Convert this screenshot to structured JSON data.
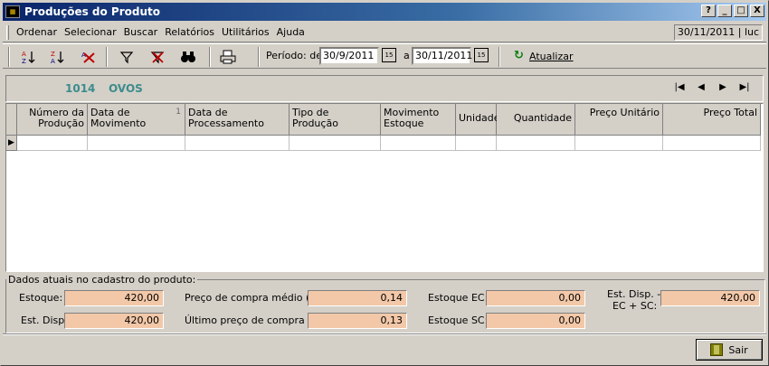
{
  "window": {
    "title": "Produções do Produto",
    "app_icon": "app-icon",
    "controls": [
      "?",
      "_",
      "□",
      "X"
    ]
  },
  "menu": {
    "items": [
      "Ordenar",
      "Selecionar",
      "Buscar",
      "Relatórios",
      "Utilitários",
      "Ajuda"
    ],
    "status": "30/11/2011 | luc"
  },
  "toolbar": {
    "buttons": [
      "sort-asc-icon",
      "sort-desc-icon",
      "clear-sort-icon",
      "filter-icon",
      "clear-filter-icon",
      "binoculars-icon",
      "print-icon"
    ],
    "periodo_label": "Período: de",
    "date_from": "30/9/2011",
    "a_label": "a",
    "date_to": "30/11/2011",
    "calendar_label": "15",
    "refresh_label": "Atualizar"
  },
  "product": {
    "code": "1014",
    "name": "OVOS",
    "nav": [
      "|◀",
      "◀",
      "▶",
      "▶|"
    ]
  },
  "grid": {
    "columns": [
      {
        "label": "Número da Produção",
        "align": "right"
      },
      {
        "label": "Data de Movimento",
        "sort_index": "1"
      },
      {
        "label": "Data de Processamento"
      },
      {
        "label": "Tipo de Produção"
      },
      {
        "label": "Movimento Estoque"
      },
      {
        "label": "Unidade"
      },
      {
        "label": "Quantidade",
        "align": "right"
      },
      {
        "label": "Preço Unitário",
        "align": "right"
      },
      {
        "label": "Preço Total",
        "align": "right"
      }
    ],
    "row_indicator": "▶"
  },
  "info": {
    "legend": "Dados atuais no cadastro do produto:",
    "estoque_label": "Estoque:",
    "estoque": "420,00",
    "est_disp_label": "Est. Disp:",
    "est_disp": "420,00",
    "preco_medio_label": "Preço de compra médio ($):",
    "preco_medio": "0,14",
    "ultimo_preco_label": "Último preço de compra ($):",
    "ultimo_preco": "0,13",
    "estoque_ec_label": "Estoque EC:",
    "estoque_ec": "0,00",
    "estoque_sc_label": "Estoque SC:",
    "estoque_sc": "0,00",
    "est_disp_ec_sc_label_1": "Est. Disp. -",
    "est_disp_ec_sc_label_2": "EC + SC:",
    "est_disp_ec_sc": "420,00"
  },
  "footer": {
    "sair_label": "Sair"
  }
}
